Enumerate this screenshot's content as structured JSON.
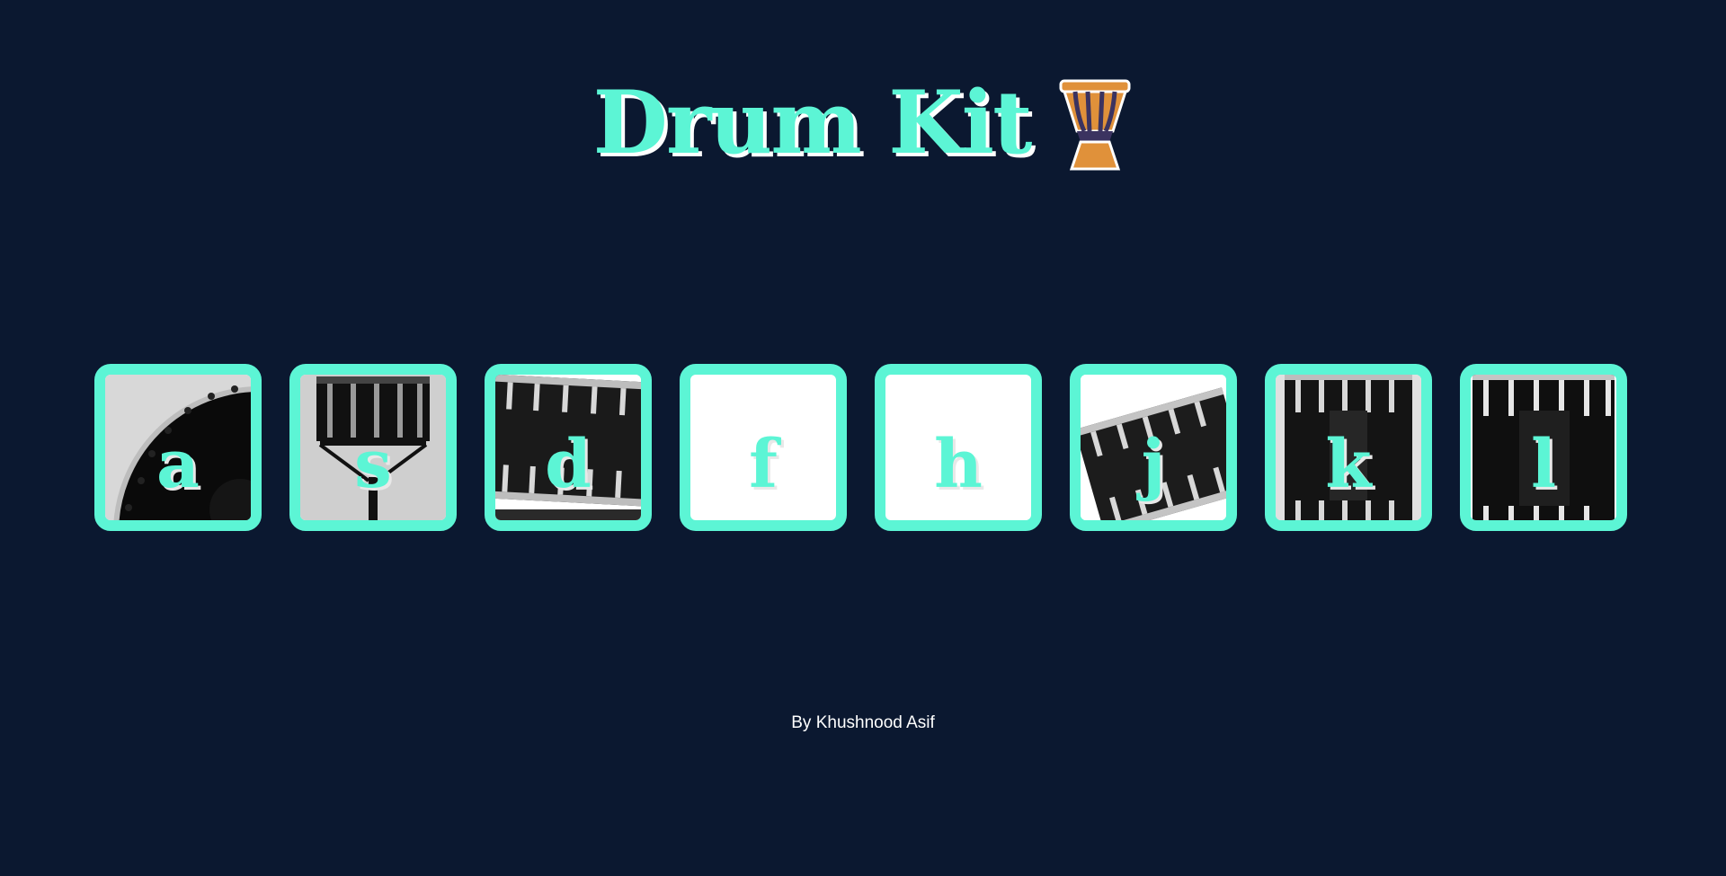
{
  "header": {
    "title": "Drum Kit",
    "icon": "djembe-drum-icon"
  },
  "drums": [
    {
      "key": "a",
      "image": "crash-cymbal-drum"
    },
    {
      "key": "s",
      "image": "snare-on-stand"
    },
    {
      "key": "d",
      "image": "tom-drum"
    },
    {
      "key": "f",
      "image": "blank"
    },
    {
      "key": "h",
      "image": "blank"
    },
    {
      "key": "j",
      "image": "tilted-tom-drum"
    },
    {
      "key": "k",
      "image": "kick-drum"
    },
    {
      "key": "l",
      "image": "floor-tom-drum"
    }
  ],
  "footer": {
    "credit": "By Khushnood Asif"
  },
  "colors": {
    "background": "#0b1830",
    "accent": "#5cf5d5",
    "text_shadow": "#ffffff",
    "drum_icon": "#e0913a",
    "drum_icon_strings": "#3b3360"
  }
}
